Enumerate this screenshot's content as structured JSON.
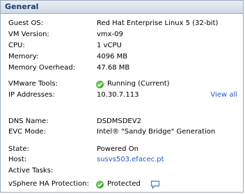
{
  "header": {
    "title": "General"
  },
  "rows": {
    "guest_os": {
      "label": "Guest OS:",
      "value": "Red Hat Enterprise Linux 5 (32-bit)"
    },
    "vm_version": {
      "label": "VM Version:",
      "value": "vmx-09"
    },
    "cpu": {
      "label": "CPU:",
      "value": "1 vCPU"
    },
    "memory": {
      "label": "Memory:",
      "value": "4096 MB"
    },
    "memory_overhead": {
      "label": "Memory Overhead:",
      "value": "47.68 MB"
    },
    "vmware_tools": {
      "label": "VMware Tools:",
      "value": "Running (Current)"
    },
    "ip_addresses": {
      "label": "IP Addresses:",
      "value": "10.30.7.113",
      "action": "View all"
    },
    "dns_name": {
      "label": "DNS Name:",
      "value": "DSDMSDEV2"
    },
    "evc_mode": {
      "label": "EVC Mode:",
      "value": "Intel® \"Sandy Bridge\" Generation"
    },
    "state": {
      "label": "State:",
      "value": "Powered On"
    },
    "host": {
      "label": "Host:",
      "value": "susvs503.efacec.pt"
    },
    "active_tasks": {
      "label": "Active Tasks:",
      "value": ""
    },
    "ha_protection": {
      "label": "vSphere HA Protection:",
      "value": "Protected"
    }
  },
  "icons": {
    "status": "green-check-icon",
    "details": "speech-bubble-icon"
  },
  "colors": {
    "header_text": "#1d3e66",
    "link": "#1f59c5",
    "status_green": "#2a9a1a"
  }
}
